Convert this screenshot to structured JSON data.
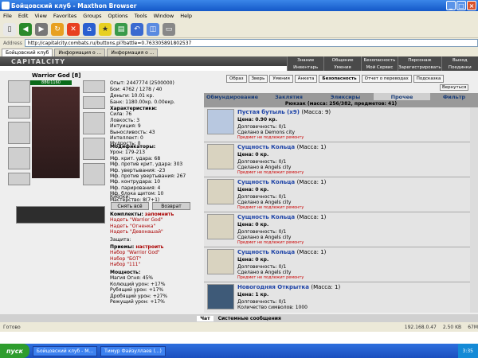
{
  "window": {
    "title": "Бойцовский клуб - Maxthon Browser"
  },
  "menu": [
    "File",
    "Edit",
    "View",
    "Favorites",
    "Groups",
    "Options",
    "Tools",
    "Window",
    "Help"
  ],
  "address": {
    "label": "Address",
    "url": "http://capitalcity.combats.ru/buttons.pl?battle=0.763305891802537"
  },
  "tabs": [
    "Бойцовский клуб",
    "Информация о ...",
    "Информация о ..."
  ],
  "game": {
    "logo": "CAPITALCITY",
    "nav": [
      "Знание",
      "Общение",
      "Безопасность",
      "Персонаж",
      "Выход"
    ],
    "nav2": [
      "Инвентарь",
      "Умения",
      "Мой Сервис",
      "Зарегистрировать",
      "Поединки"
    ]
  },
  "character": {
    "name": "Warrior God [8]",
    "hp": "886/1160",
    "exp": "Опыт: 2447774 (2500000)",
    "wins": "Бои: 4762 / 1278 / 40",
    "money": "Деньги: 10.01 кр.",
    "bank": "Банк: 1180.00кр. 0.00екр."
  },
  "sections": {
    "characteristics": "Характеристики:",
    "stats": [
      "Сила: 76",
      "Ловкость: 3",
      "Интуиция: 9",
      "Выносливость: 43",
      "Интеллект: 0",
      "Мудрость: 0"
    ],
    "modifiers": "Модификаторы:",
    "mods": [
      "Урон: 179-213",
      "Мф. крит. удара: 68",
      "Мф. против крит. удара: 303",
      "Мф. увертывания: -23",
      "Мф. против увертывания: 267",
      "Мф. контрудара: 10",
      "Мф. парирования: 4",
      "Мф. блока щитом: 10",
      "Мастерство: 8(7+1)"
    ],
    "buttons_label": "Кнопки:",
    "take_off": "Снять всё",
    "return": "Возврат",
    "kits": "Комплекты:",
    "remember": "запомнить",
    "kit_items": [
      "Надеть \"Warrior God\"",
      "Надеть \"Огненка\"",
      "Надеть \"Девонашай\""
    ],
    "protection": "Защита:",
    "tactics": "Приемы:",
    "configure": "настроить",
    "tactic_items": [
      "Набор \"Warrior God\"",
      "Набор \"БОТ\"",
      "Набор \"111\""
    ],
    "power": "Мощность:",
    "power_items": [
      "Магия Огня: 45%",
      "Колющий урон: +17%",
      "Рубящий урон: +17%",
      "Дробящий урон: +27%",
      "Режущий урон: +17%"
    ]
  },
  "top_buttons": [
    "Образ",
    "Зверь",
    "Умения",
    "Анкета",
    "Безопасность",
    "Отчет о переводах",
    "Подсказка"
  ],
  "return_btn": "Вернуться",
  "inventory": {
    "tabs": [
      "Обмундирование",
      "Заклятия",
      "Эликсиры",
      "Прочее",
      "Фильтр"
    ],
    "summary": "Рюкзак (масса: 256/382, предметов: 41)",
    "items": [
      {
        "title": "Пустая бутыль (x9)",
        "mass": "(Масса: 9)",
        "price": "Цена: 0.90 кр.",
        "dur": "Долговечность: 0/1",
        "made": "Сделано в Demons city",
        "warn": "Предмет не подлежит ремонту"
      },
      {
        "title": "Сущность Кольца",
        "mass": "(Масса: 1)",
        "price": "Цена: 0 кр.",
        "dur": "Долговечность: 0/1",
        "made": "Сделано в Angels city",
        "warn": "Предмет не подлежит ремонту"
      },
      {
        "title": "Сущность Кольца",
        "mass": "(Масса: 1)",
        "price": "Цена: 0 кр.",
        "dur": "Долговечность: 0/1",
        "made": "Сделано в Angels city",
        "warn": "Предмет не подлежит ремонту"
      },
      {
        "title": "Сущность Кольца",
        "mass": "(Масса: 1)",
        "price": "Цена: 0 кр.",
        "dur": "Долговечность: 0/1",
        "made": "Сделано в Angels city",
        "warn": "Предмет не подлежит ремонту"
      },
      {
        "title": "Сущность Кольца",
        "mass": "(Масса: 1)",
        "price": "Цена: 0 кр.",
        "dur": "Долговечность: 0/1",
        "made": "Сделано в Angels city",
        "warn": "Предмет не подлежит ремонту"
      },
      {
        "title": "Новогодняя Открытка",
        "mass": "(Масса: 1)",
        "price": "Цена: 1 кр.",
        "dur": "Долговечность: 0/1",
        "made": "Количество символов: 1000",
        "warn": ""
      }
    ]
  },
  "chat": [
    "Чат",
    "Системные сообщения"
  ],
  "status": {
    "text": "Готово",
    "ip": "192.168.0.47",
    "speed": "2.50 KB",
    "mem": "67M"
  },
  "taskbar": {
    "start": "пуск",
    "tasks": [
      "Бойцовский клуб - М...",
      "Тимур Файзуллаев (...)"
    ],
    "clock": "3:35"
  }
}
